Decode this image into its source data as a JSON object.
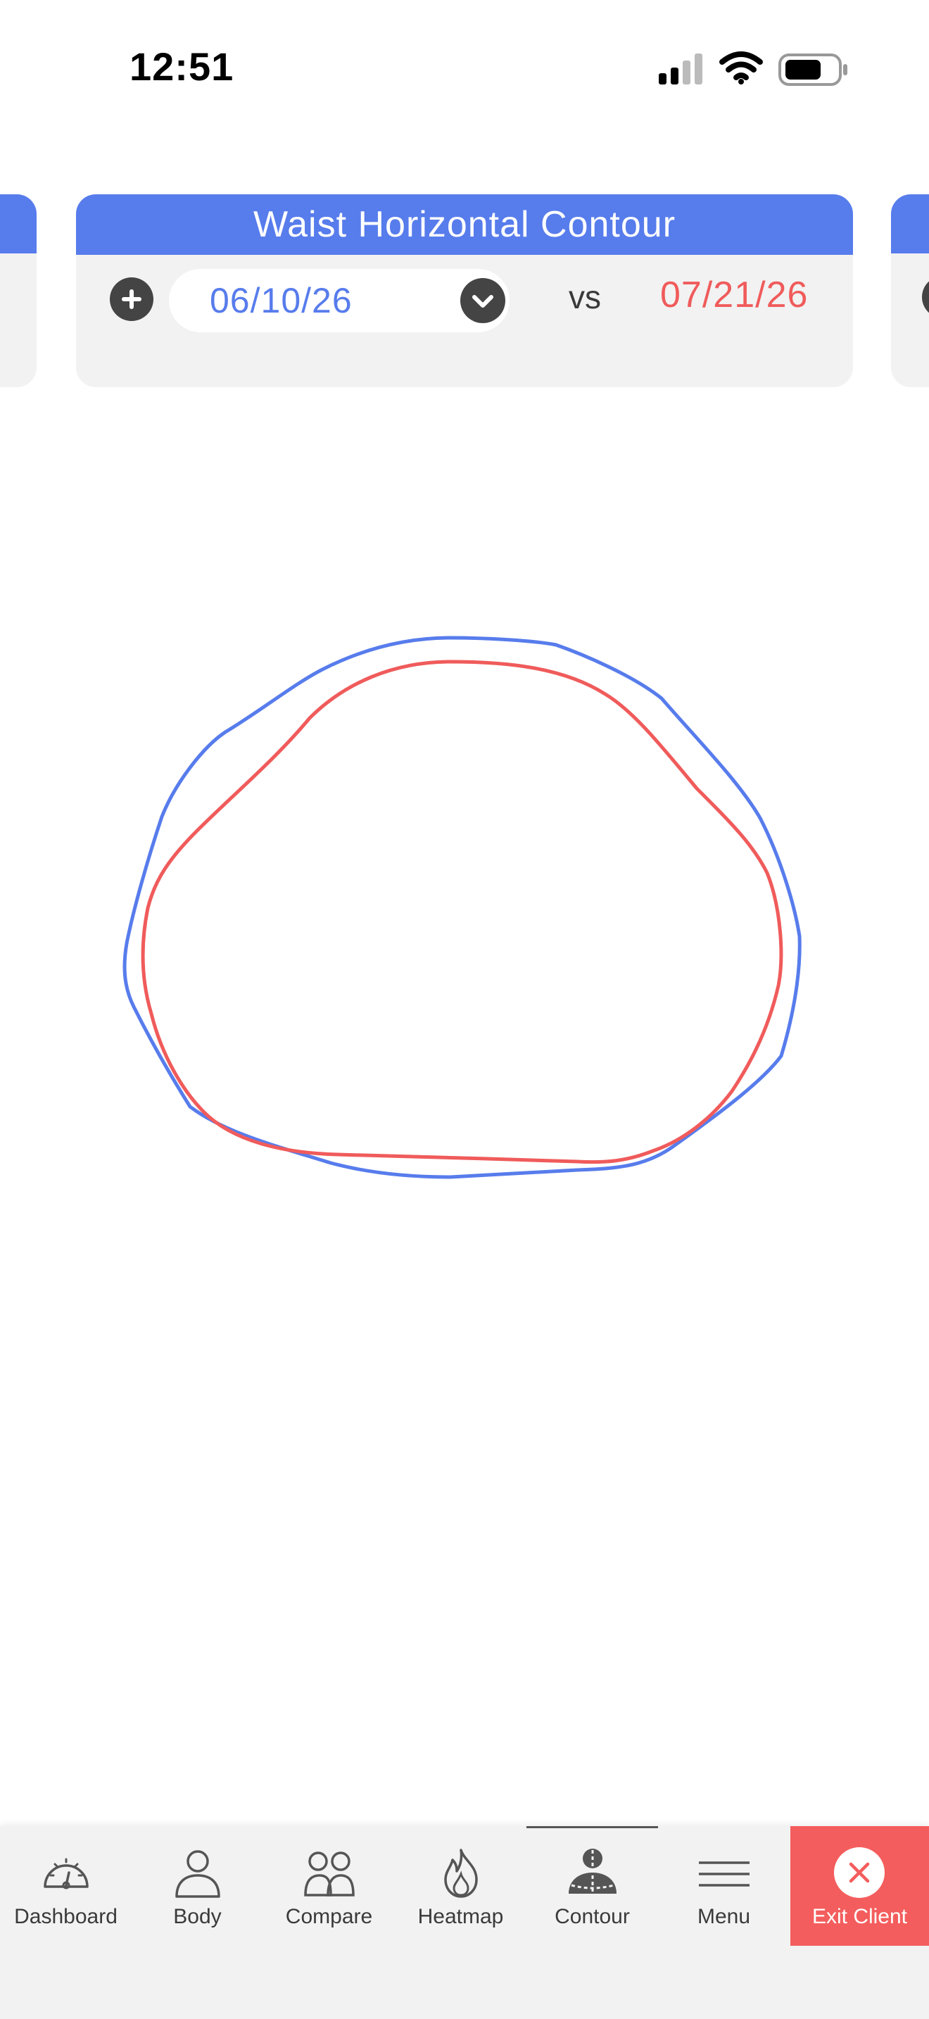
{
  "status_bar": {
    "time": "12:51",
    "icons": [
      "cellular-signal-icon",
      "wifi-icon",
      "battery-icon"
    ]
  },
  "card": {
    "title": "Waist Horizontal Contour",
    "baseline_date": "06/10/26",
    "vs_label": "vs",
    "compare_date": "07/21/26"
  },
  "colors": {
    "accent_blue": "#577cec",
    "compare_red": "#f05b5b",
    "exit_red": "#f45d5d",
    "dark_icon": "#444444"
  },
  "contour_chart": {
    "series": [
      {
        "color": "#577cec"
      },
      {
        "color": "#f05b5b"
      }
    ]
  },
  "bottom_nav": {
    "items": [
      {
        "label": "Dashboard",
        "icon": "speedometer-icon"
      },
      {
        "label": "Body",
        "icon": "person-icon"
      },
      {
        "label": "Compare",
        "icon": "people-icon"
      },
      {
        "label": "Heatmap",
        "icon": "flame-icon"
      },
      {
        "label": "Contour",
        "icon": "body-contour-icon",
        "active": true
      },
      {
        "label": "Menu",
        "icon": "menu-icon"
      },
      {
        "label": "Exit Client",
        "icon": "close-icon"
      }
    ]
  }
}
